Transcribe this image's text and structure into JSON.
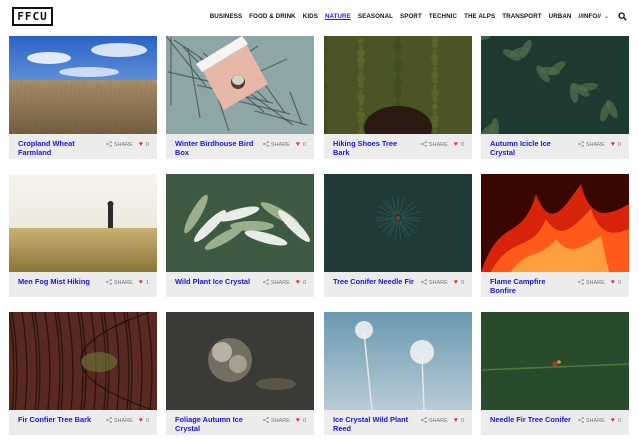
{
  "logo": "FFCU",
  "nav": {
    "items": [
      "BUSINESS",
      "FOOD & DRINK",
      "KIDS",
      "NATURE",
      "SEASONAL",
      "SPORT",
      "TECHNIC",
      "THE ALPS",
      "TRANSPORT",
      "URBAN",
      "//INFO//"
    ],
    "active": "NATURE",
    "dropdown_icon": "chevron-down-icon",
    "search_icon": "search-icon"
  },
  "cards": [
    {
      "title": "Cropland Wheat Farmland",
      "share": "SHARE",
      "likes": "0",
      "scene": "wheat"
    },
    {
      "title": "Winter Birdhouse Bird Box",
      "share": "SHARE",
      "likes": "0",
      "scene": "birdhouse"
    },
    {
      "title": "Hiking Shoes Tree Bark",
      "share": "SHARE",
      "likes": "0",
      "scene": "moss"
    },
    {
      "title": "Autumn Icicle Ice Crystal",
      "share": "SHARE",
      "likes": "0",
      "scene": "leaves"
    },
    {
      "title": "Men Fog Mist Hiking",
      "share": "SHARE",
      "likes": "1",
      "scene": "fog"
    },
    {
      "title": "Wild Plant Ice Crystal",
      "share": "SHARE",
      "likes": "0",
      "scene": "plant"
    },
    {
      "title": "Tree Conifer Needle Fir",
      "share": "SHARE",
      "likes": "0",
      "scene": "conifer"
    },
    {
      "title": "Flame Campfire Bonfire",
      "share": "SHARE",
      "likes": "0",
      "scene": "fire"
    },
    {
      "title": "Fir Confier Tree Bark",
      "share": "SHARE",
      "likes": "0",
      "scene": "bark"
    },
    {
      "title": "Foliage Autumn Ice Crystal",
      "share": "SHARE",
      "likes": "0",
      "scene": "foliage"
    },
    {
      "title": "Ice Crystal Wild Plant Reed",
      "share": "SHARE",
      "likes": "0",
      "scene": "reed"
    },
    {
      "title": "Needle Fir Tree Conifer",
      "share": "SHARE",
      "likes": "0",
      "scene": "needle"
    }
  ],
  "colors": {
    "link": "#1a14e0",
    "active_nav": "#1a1aff",
    "heart": "#e0382e",
    "card_bg": "#ececec"
  }
}
